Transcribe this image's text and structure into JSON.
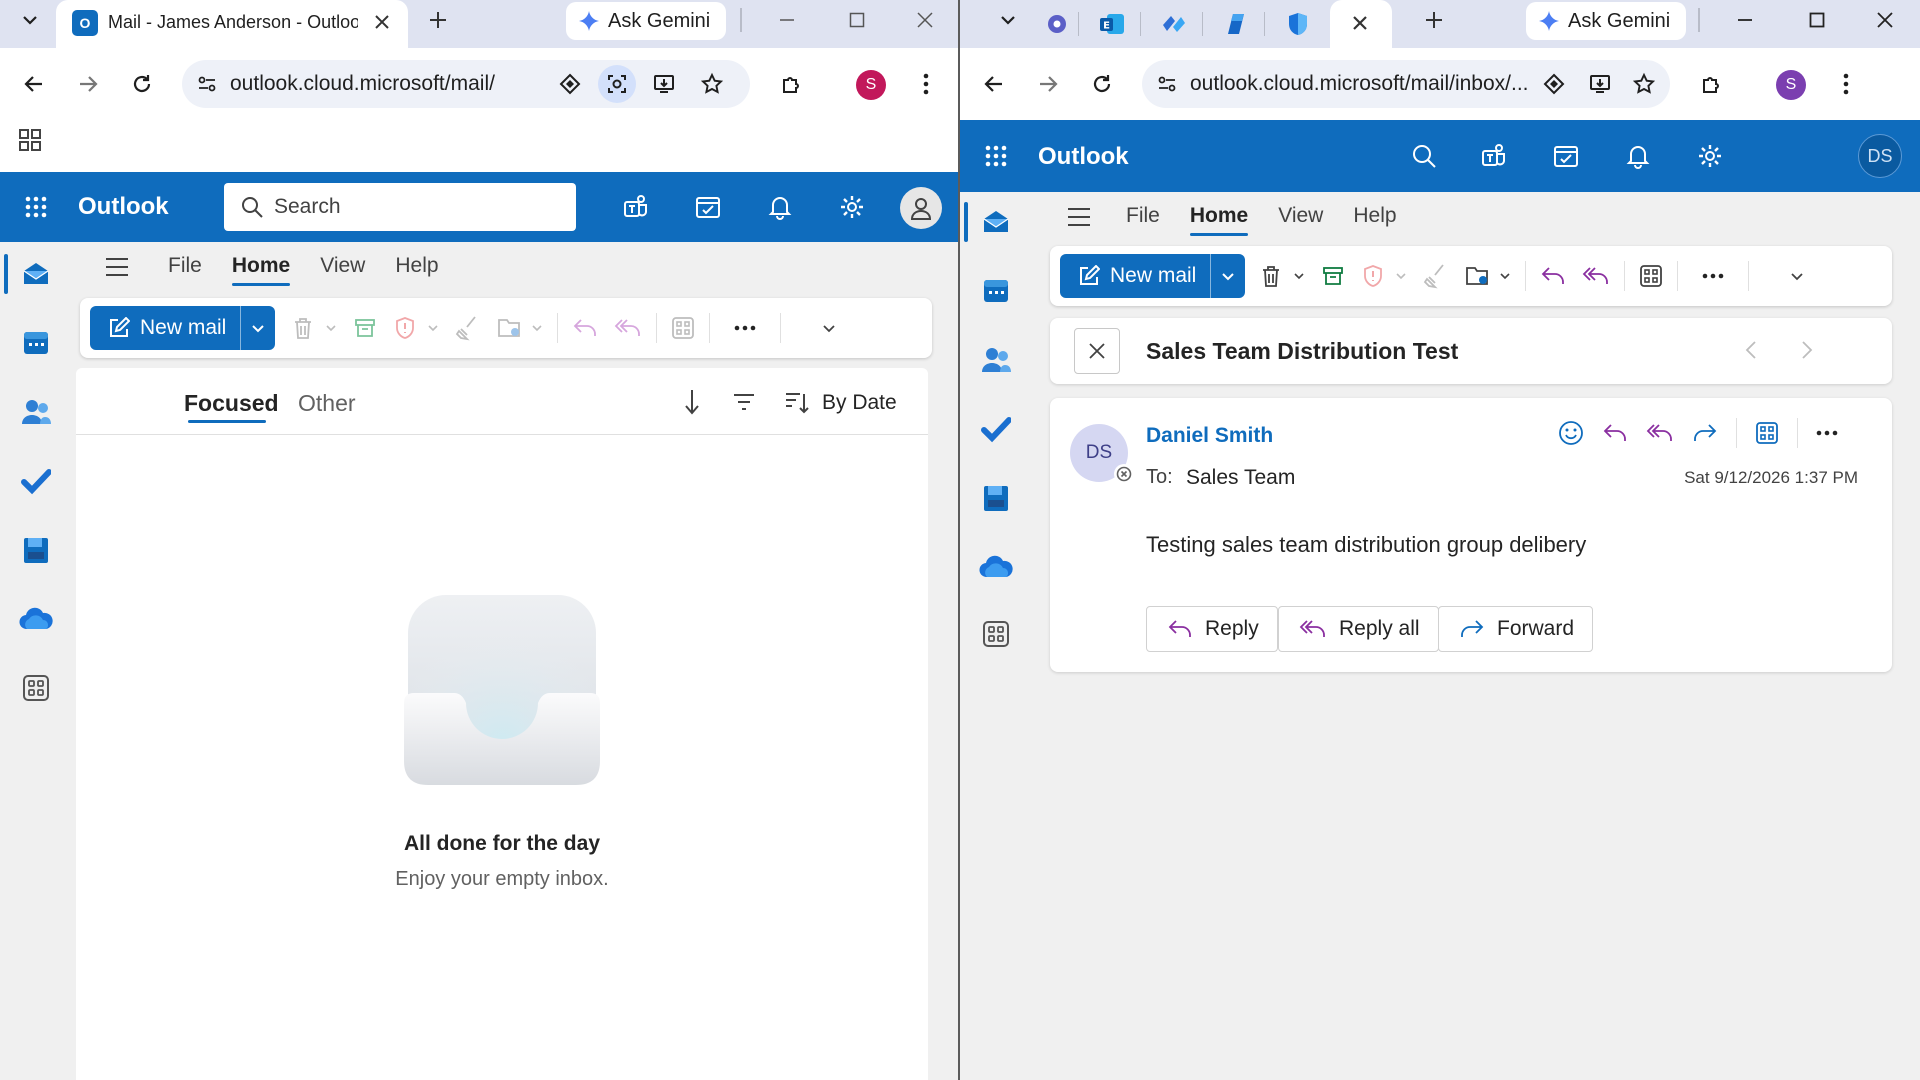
{
  "left": {
    "tab_title": "Mail - James Anderson - Outlook",
    "gemini_label": "Ask Gemini",
    "url": "outlook.cloud.microsoft/mail/",
    "profile_initial": "S",
    "app_name": "Outlook",
    "search_placeholder": "Search",
    "menu": [
      "File",
      "Home",
      "View",
      "Help"
    ],
    "active_menu": "Home",
    "new_mail_label": "New mail",
    "pivot_focused": "Focused",
    "pivot_other": "Other",
    "sort_label": "By Date",
    "empty_title": "All done for the day",
    "empty_subtitle": "Enjoy your empty inbox."
  },
  "right": {
    "gemini_label": "Ask Gemini",
    "url": "outlook.cloud.microsoft/mail/inbox/...",
    "profile_initial": "S",
    "app_name": "Outlook",
    "user_initials": "DS",
    "menu": [
      "File",
      "Home",
      "View",
      "Help"
    ],
    "active_menu": "Home",
    "new_mail_label": "New mail",
    "subject": "Sales Team Distribution Test",
    "message": {
      "sender": "Daniel Smith",
      "sender_initials": "DS",
      "to_label": "To:",
      "to_value": "Sales Team",
      "date": "Sat 9/12/2026 1:37 PM",
      "body": "Testing sales team distribution group delibery",
      "reply_label": "Reply",
      "reply_all_label": "Reply all",
      "forward_label": "Forward"
    }
  },
  "colors": {
    "outlook_blue": "#0f6cbd",
    "tabstrip": "#dfe3f1",
    "profile_left": "#c2185b",
    "profile_right": "#7b3fb0",
    "reply_purple": "#8a2fa0",
    "archive_green": "#107c41",
    "block_red": "#d13438"
  },
  "icons": {
    "apps": "waffle-icon",
    "mail": "mail-icon",
    "calendar": "calendar-icon",
    "people": "people-icon",
    "todo": "checkmark-icon",
    "onedrive": "cloud-icon",
    "settings": "gear-icon",
    "notifications": "bell-icon"
  }
}
